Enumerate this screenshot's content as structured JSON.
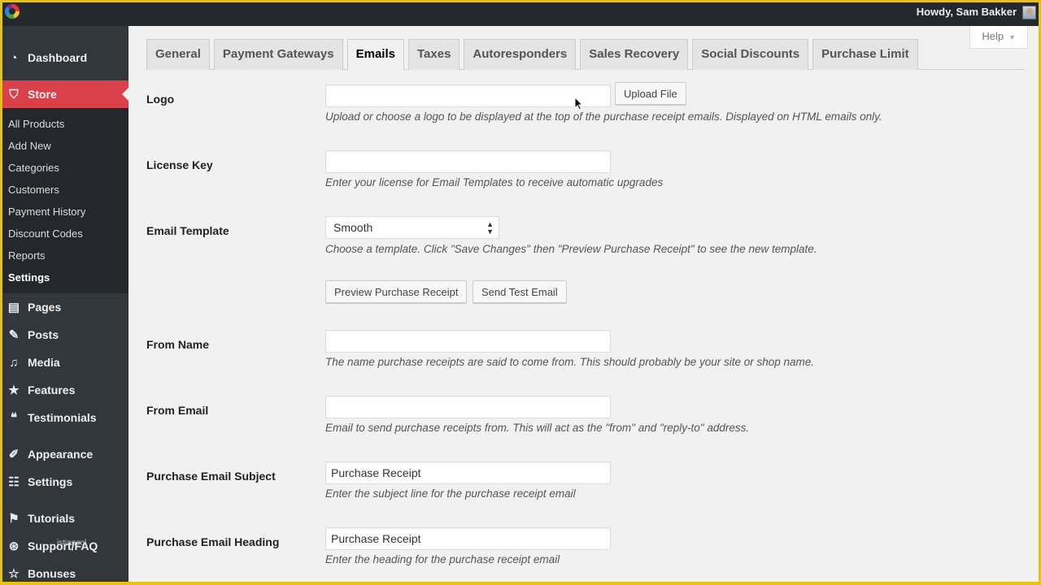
{
  "adminbar": {
    "greeting": "Howdy, Sam Bakker"
  },
  "sidebar": {
    "items": [
      {
        "label": "Dashboard",
        "icon": "dashboard-icon",
        "glyph": "◔"
      },
      {
        "label": "Store",
        "icon": "store-icon",
        "glyph": "⛉",
        "current": true
      },
      {
        "label": "Pages",
        "icon": "pages-icon",
        "glyph": "▤"
      },
      {
        "label": "Posts",
        "icon": "pin-icon",
        "glyph": "✎"
      },
      {
        "label": "Media",
        "icon": "media-icon",
        "glyph": "♫"
      },
      {
        "label": "Features",
        "icon": "star-icon",
        "glyph": "★"
      },
      {
        "label": "Testimonials",
        "icon": "quote-icon",
        "glyph": "❝"
      },
      {
        "label": "Appearance",
        "icon": "paintbrush-icon",
        "glyph": "✐"
      },
      {
        "label": "Settings",
        "icon": "settings-icon",
        "glyph": "☷"
      },
      {
        "label": "Tutorials",
        "icon": "graduation-cap-icon",
        "glyph": "⚑"
      },
      {
        "label": "Support/FAQ",
        "icon": "lifebuoy-icon",
        "glyph": "⊛"
      },
      {
        "label": "Bonuses",
        "icon": "star-outline-icon",
        "glyph": "☆"
      }
    ],
    "submenu": [
      {
        "label": "All Products"
      },
      {
        "label": "Add New"
      },
      {
        "label": "Categories"
      },
      {
        "label": "Customers"
      },
      {
        "label": "Payment History"
      },
      {
        "label": "Discount Codes"
      },
      {
        "label": "Reports"
      },
      {
        "label": "Settings",
        "active": true
      }
    ],
    "overlay_text": "istiancol"
  },
  "help": {
    "label": "Help"
  },
  "tabs": [
    {
      "label": "General"
    },
    {
      "label": "Payment Gateways"
    },
    {
      "label": "Emails",
      "active": true
    },
    {
      "label": "Taxes"
    },
    {
      "label": "Autoresponders"
    },
    {
      "label": "Sales Recovery"
    },
    {
      "label": "Social Discounts"
    },
    {
      "label": "Purchase Limit"
    }
  ],
  "form": {
    "logo": {
      "label": "Logo",
      "value": "",
      "button": "Upload File",
      "description": "Upload or choose a logo to be displayed at the top of the purchase receipt emails. Displayed on HTML emails only."
    },
    "license_key": {
      "label": "License Key",
      "value": "",
      "description": "Enter your license for Email Templates to receive automatic upgrades"
    },
    "email_template": {
      "label": "Email Template",
      "selected": "Smooth",
      "description": "Choose a template. Click \"Save Changes\" then \"Preview Purchase Receipt\" to see the new template.",
      "preview_button": "Preview Purchase Receipt",
      "test_button": "Send Test Email"
    },
    "from_name": {
      "label": "From Name",
      "value": "",
      "description": "The name purchase receipts are said to come from. This should probably be your site or shop name."
    },
    "from_email": {
      "label": "From Email",
      "value": "",
      "description": "Email to send purchase receipts from. This will act as the \"from\" and \"reply-to\" address."
    },
    "subject": {
      "label": "Purchase Email Subject",
      "value": "Purchase Receipt",
      "description": "Enter the subject line for the purchase receipt email"
    },
    "heading": {
      "label": "Purchase Email Heading",
      "value": "Purchase Receipt",
      "description": "Enter the heading for the purchase receipt email"
    }
  },
  "colors": {
    "accent": "#d9404a",
    "sidebar": "#32373c",
    "frame": "#e3c21b"
  }
}
